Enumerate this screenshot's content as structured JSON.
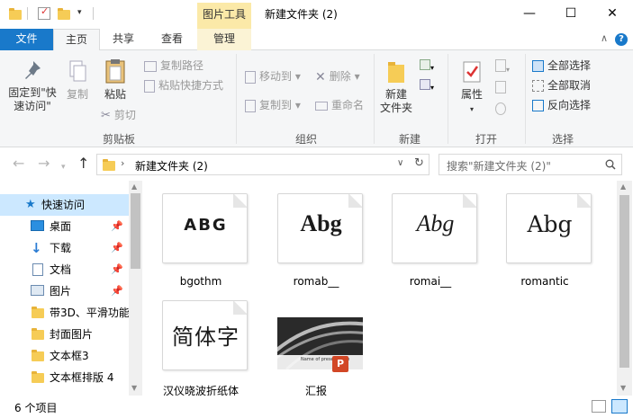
{
  "titlebar": {
    "context_tab": "图片工具",
    "title": "新建文件夹 (2)",
    "minimize": "—",
    "maximize": "☐",
    "close": "✕"
  },
  "tabs": {
    "file": "文件",
    "home": "主页",
    "share": "共享",
    "view": "查看",
    "manage": "管理"
  },
  "ribbon": {
    "clipboard": {
      "pin_label_1": "固定到\"快",
      "pin_label_2": "速访问\"",
      "copy": "复制",
      "paste": "粘贴",
      "copy_path": "复制路径",
      "paste_shortcut": "粘贴快捷方式",
      "cut": "剪切",
      "group": "剪贴板"
    },
    "organize": {
      "move_to": "移动到",
      "copy_to": "复制到",
      "delete": "删除",
      "rename": "重命名",
      "group": "组织"
    },
    "new": {
      "new_folder_1": "新建",
      "new_folder_2": "文件夹",
      "group": "新建"
    },
    "open": {
      "properties": "属性",
      "group": "打开"
    },
    "select": {
      "select_all": "全部选择",
      "select_none": "全部取消",
      "invert": "反向选择",
      "group": "选择"
    }
  },
  "address": {
    "path": "新建文件夹 (2)",
    "search_placeholder": "搜索\"新建文件夹 (2)\""
  },
  "nav": {
    "items": [
      {
        "label": "快速访问"
      },
      {
        "label": "桌面"
      },
      {
        "label": "下载"
      },
      {
        "label": "文档"
      },
      {
        "label": "图片"
      },
      {
        "label": "带3D、平滑功能"
      },
      {
        "label": "封面图片"
      },
      {
        "label": "文本框3"
      },
      {
        "label": "文本框排版 4"
      }
    ]
  },
  "files": [
    {
      "name": "bgothm",
      "preview": "ABG"
    },
    {
      "name": "romab__",
      "preview": "Abg"
    },
    {
      "name": "romai__",
      "preview": "Abg"
    },
    {
      "name": "romantic",
      "preview": "Abg"
    },
    {
      "name": "汉仪晓波折纸体",
      "preview": "简体字"
    },
    {
      "name": "汇报",
      "preview_caption": "Name of presentation"
    }
  ],
  "status": {
    "count": "6 个项目"
  },
  "colors": {
    "accent": "#1979ca",
    "context_tab": "#fbe9a8",
    "selection": "#cce8ff"
  }
}
